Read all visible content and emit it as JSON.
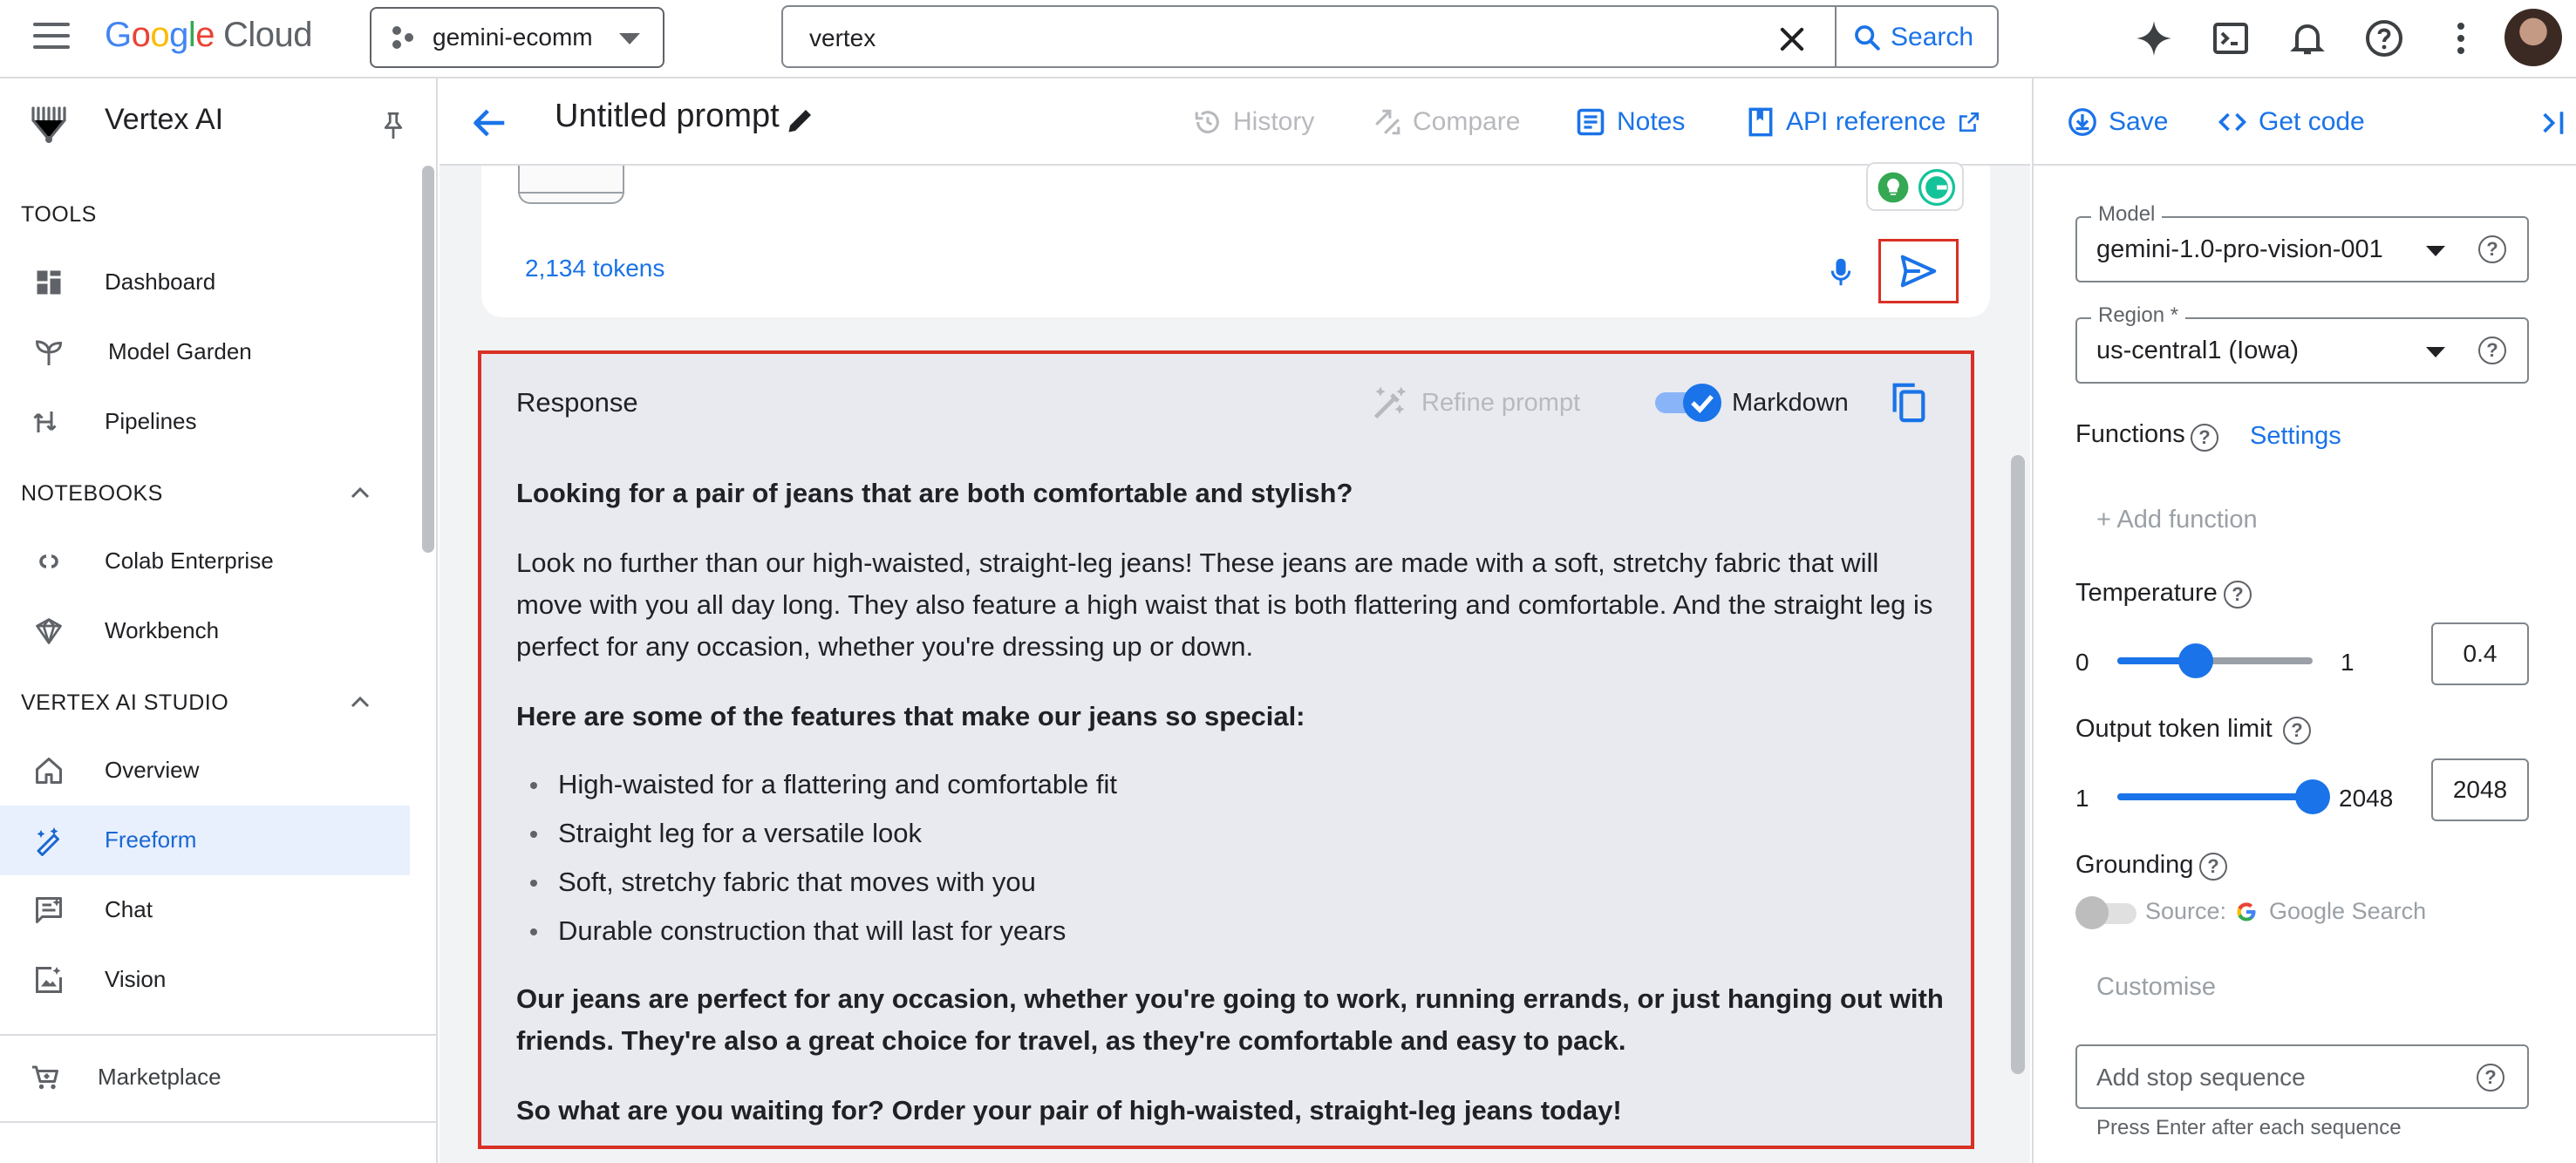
{
  "topbar": {
    "logo_letters": [
      "G",
      "o",
      "o",
      "g",
      "l",
      "e"
    ],
    "logo_suffix": "Cloud",
    "project": "gemini-ecomm",
    "search_value": "vertex",
    "search_label": "Search",
    "icons": [
      "gemini-icon",
      "cloud-shell-icon",
      "notifications-icon",
      "help-icon",
      "more-vert-icon",
      "avatar"
    ]
  },
  "sidebar": {
    "title": "Vertex AI",
    "sections": [
      {
        "label": "TOOLS",
        "items": [
          {
            "label": "Dashboard",
            "icon": "dashboard-icon"
          },
          {
            "label": "Model Garden",
            "icon": "model-garden-icon"
          },
          {
            "label": "Pipelines",
            "icon": "pipelines-icon"
          }
        ]
      },
      {
        "label": "NOTEBOOKS",
        "items": [
          {
            "label": "Colab Enterprise",
            "icon": "colab-icon"
          },
          {
            "label": "Workbench",
            "icon": "workbench-icon"
          }
        ]
      },
      {
        "label": "VERTEX AI STUDIO",
        "items": [
          {
            "label": "Overview",
            "icon": "home-icon"
          },
          {
            "label": "Freeform",
            "icon": "freeform-icon",
            "active": true
          },
          {
            "label": "Chat",
            "icon": "chat-icon"
          },
          {
            "label": "Vision",
            "icon": "vision-icon"
          }
        ]
      }
    ],
    "footer_item": {
      "label": "Marketplace",
      "icon": "marketplace-icon"
    }
  },
  "center": {
    "title": "Untitled prompt",
    "actions": {
      "history": "History",
      "compare": "Compare",
      "notes": "Notes",
      "api_reference": "API reference"
    },
    "prompt": {
      "tokens": "2,134 tokens"
    },
    "response": {
      "title": "Response",
      "refine": "Refine prompt",
      "markdown": "Markdown",
      "markdown_on": true,
      "heading": "Looking for a pair of jeans that are both comfortable and stylish?",
      "para1": "Look no further than our high-waisted, straight-leg jeans! These jeans are made with a soft, stretchy fabric that will move with you all day long. They also feature a high waist that is both flattering and comfortable. And the straight leg is perfect for any occasion, whether you're dressing up or down.",
      "features_heading": "Here are some of the features that make our jeans so special:",
      "features": [
        "High-waisted for a flattering and comfortable fit",
        "Straight leg for a versatile look",
        "Soft, stretchy fabric that moves with you",
        "Durable construction that will last for years"
      ],
      "para2": "Our jeans are perfect for any occasion, whether you're going to work, running errands, or just hanging out with friends. They're also a great choice for travel, as they're comfortable and easy to pack.",
      "cta": "So what are you waiting for? Order your pair of high-waisted, straight-leg jeans today!"
    }
  },
  "rpanel": {
    "save": "Save",
    "get_code": "Get code",
    "model": {
      "label": "Model",
      "value": "gemini-1.0-pro-vision-001"
    },
    "region": {
      "label": "Region *",
      "value": "us-central1 (Iowa)"
    },
    "functions": {
      "label": "Functions",
      "settings": "Settings",
      "add": "+ Add function"
    },
    "temperature": {
      "label": "Temperature",
      "min": "0",
      "max": "1",
      "value": "0.4",
      "fraction": 0.4
    },
    "output_limit": {
      "label": "Output token limit",
      "min": "1",
      "max": "2048",
      "value": "2048",
      "fraction": 1.0
    },
    "grounding": {
      "label": "Grounding",
      "source_prefix": "Source:",
      "source": "Google Search",
      "enabled": false
    },
    "customise": "Customise",
    "stop_sequence": {
      "placeholder": "Add stop sequence",
      "hint": "Press Enter after each sequence"
    }
  },
  "colors": {
    "accent": "#1a73e8",
    "highlight_border": "#d93025",
    "active_nav_bg": "#e8f0fe",
    "response_bg": "#e8eaf0"
  }
}
